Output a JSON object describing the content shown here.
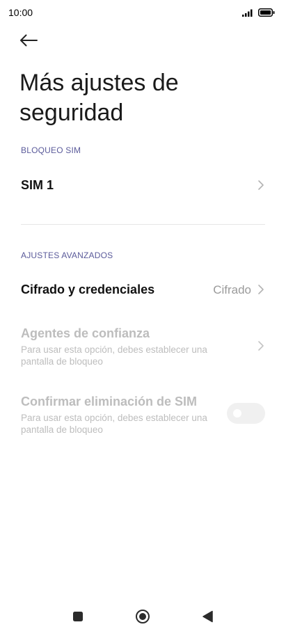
{
  "status_bar": {
    "time": "10:00",
    "icons": [
      "signal-icon",
      "battery-icon"
    ]
  },
  "header": {
    "back_icon": "arrow-left-icon",
    "title": "Más ajustes de seguridad"
  },
  "sections": [
    {
      "header": "BLOQUEO SIM",
      "items": [
        {
          "title": "SIM 1",
          "enabled": true,
          "icon": "chevron-right-icon"
        }
      ]
    },
    {
      "header": "AJUSTES AVANZADOS",
      "items": [
        {
          "title": "Cifrado y credenciales",
          "value": "Cifrado",
          "enabled": true,
          "icon": "chevron-right-icon"
        },
        {
          "title": "Agentes de confianza",
          "subtitle": "Para usar esta opción, debes establecer una pantalla de bloqueo",
          "enabled": false,
          "icon": "chevron-right-icon"
        },
        {
          "title": "Confirmar eliminación de SIM",
          "subtitle": "Para usar esta opción, debes establecer una pantalla de bloqueo",
          "enabled": false,
          "toggle_on": false
        }
      ]
    }
  ],
  "nav_bar": {
    "buttons": [
      "recents-square-icon",
      "home-circle-icon",
      "back-triangle-icon"
    ]
  },
  "colors": {
    "section_header": "#5a5a9a",
    "disabled_text": "#bdbdbd",
    "value_text": "#9a9a9a",
    "divider": "#e6e6e6"
  }
}
